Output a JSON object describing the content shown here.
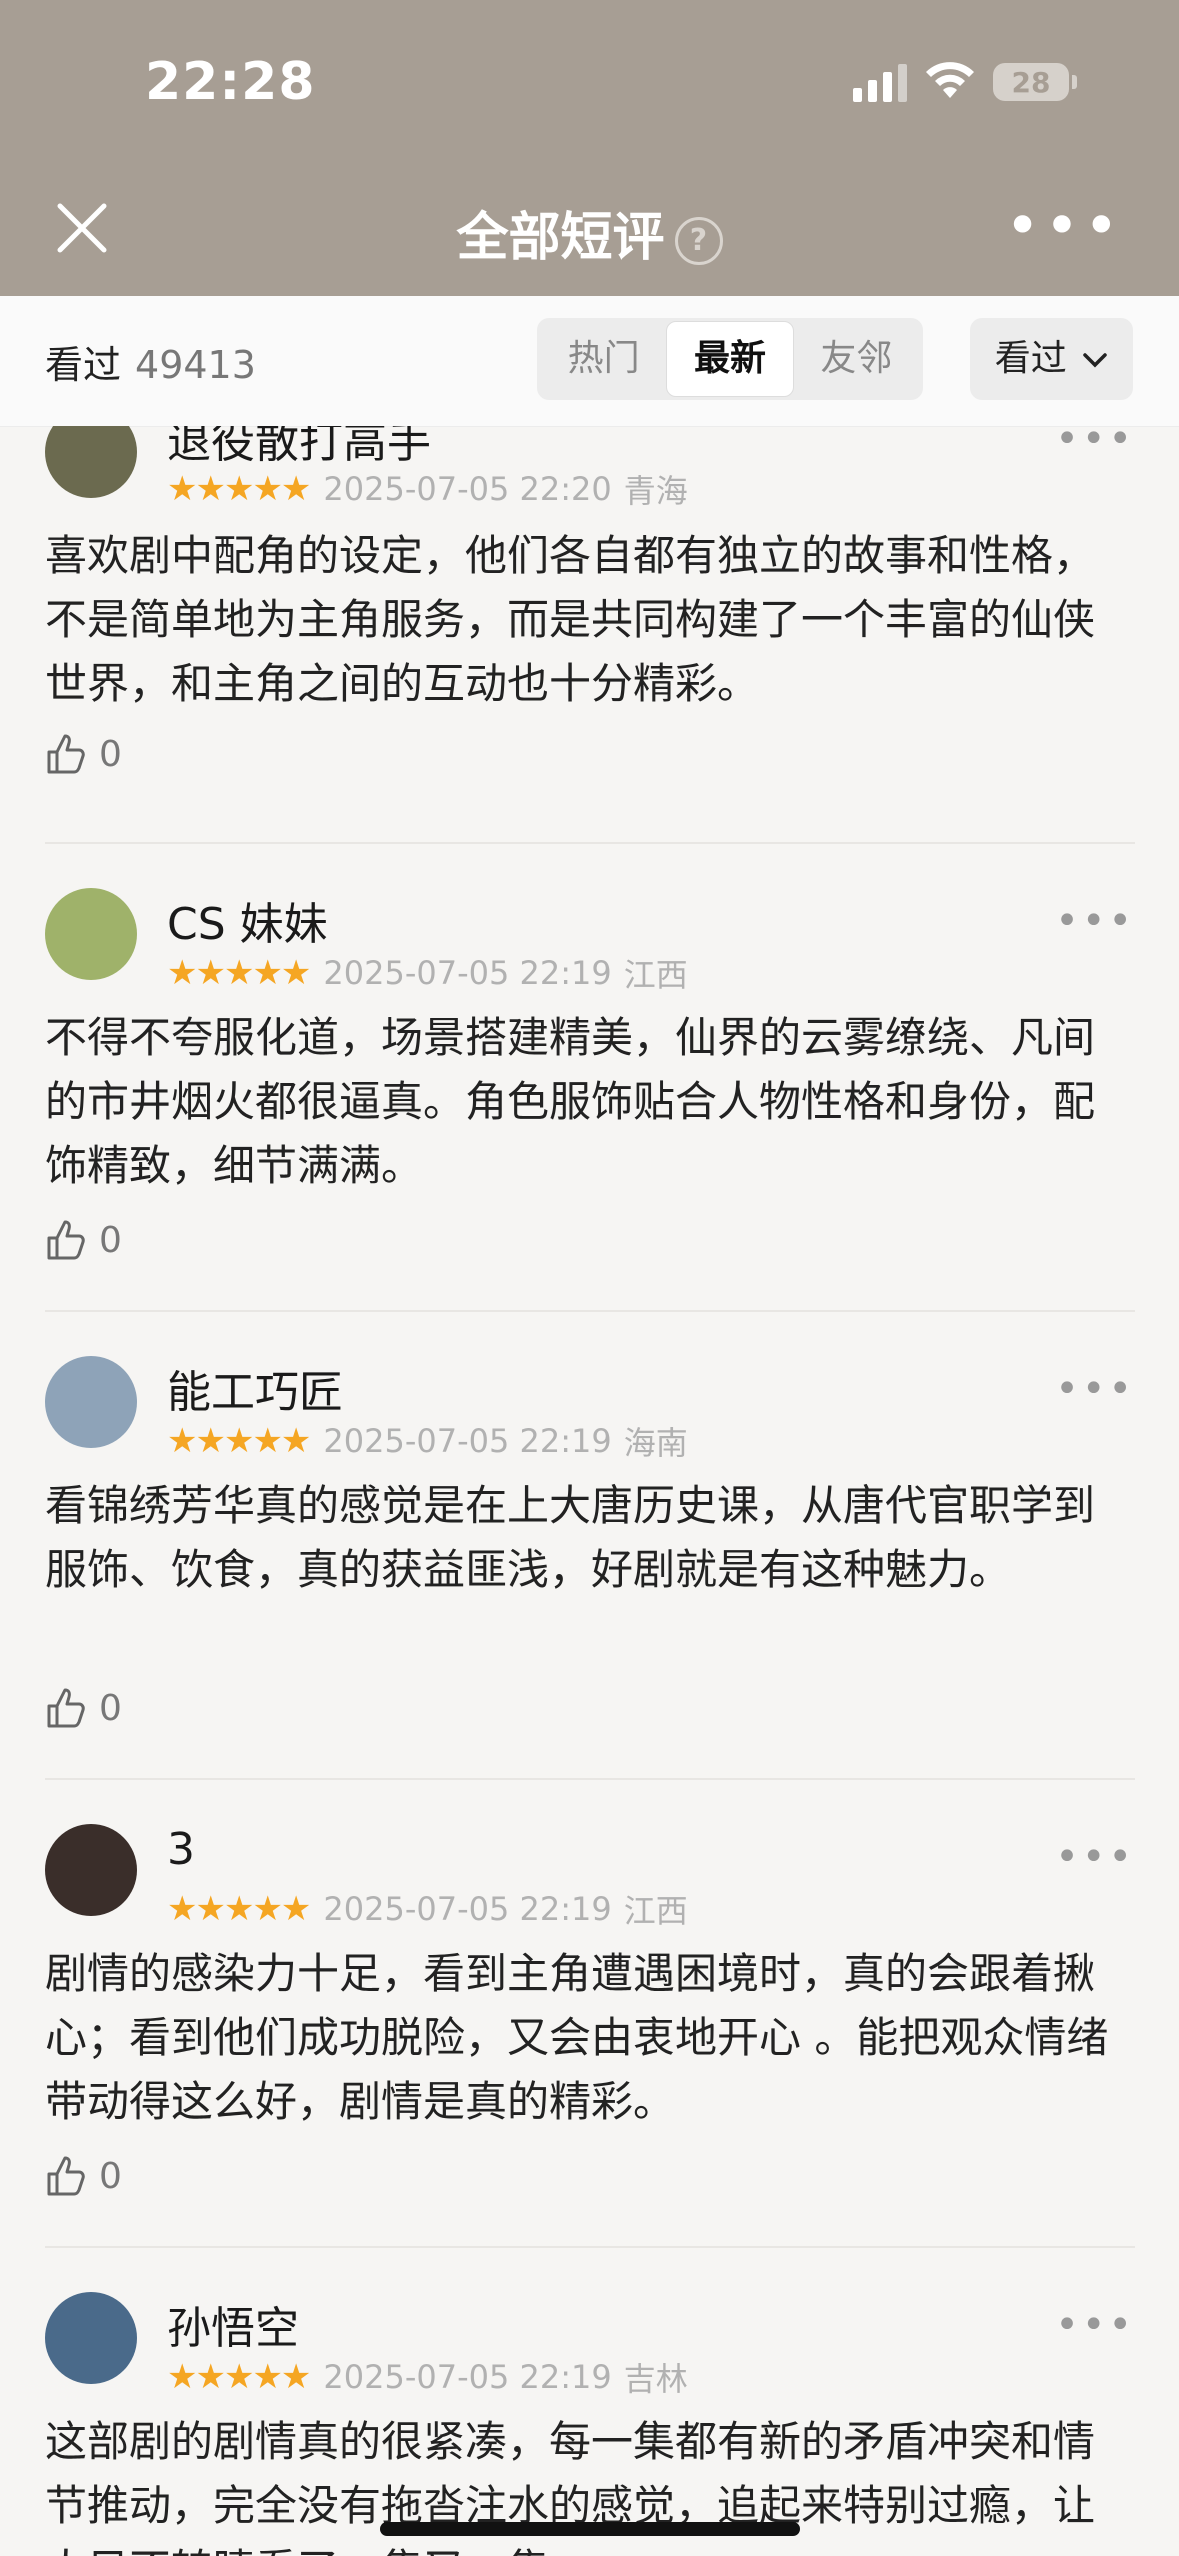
{
  "status": {
    "time": "22:28",
    "battery": "28"
  },
  "header": {
    "title": "全部短评",
    "help_glyph": "?"
  },
  "filter": {
    "count_label": "看过",
    "count_value": "49413",
    "tabs": [
      "热门",
      "最新",
      "友邻"
    ],
    "active_tab_index": 1,
    "dropdown_label": "看过"
  },
  "reviews": [
    {
      "name": "退役散打高手",
      "stars": 5,
      "date": "2025-07-05 22:20",
      "region": "青海",
      "text": "喜欢剧中配角的设定，他们各自都有独立的故事和性格，不是简单地为主角服务，而是共同构建了一个丰富的仙侠世界，和主角之间的互动也十分精彩。",
      "likes": "0",
      "avatar_color": "#6b6a4f"
    },
    {
      "name": "CS 妹妹",
      "stars": 5,
      "date": "2025-07-05 22:19",
      "region": "江西",
      "text": "不得不夸服化道，场景搭建精美，仙界的云雾缭绕、凡间的市井烟火都很逼真。角色服饰贴合人物性格和身份，配饰精致，细节满满。",
      "likes": "0",
      "avatar_color": "#9fb26a"
    },
    {
      "name": "能工巧匠",
      "stars": 5,
      "date": "2025-07-05 22:19",
      "region": "海南",
      "text": "看锦绣芳华真的感觉是在上大唐历史课，从唐代官职学到服饰、饮食，真的获益匪浅，好剧就是有这种魅力。",
      "likes": "0",
      "avatar_color": "#8ea3b8"
    },
    {
      "name": "3",
      "stars": 5,
      "date": "2025-07-05 22:19",
      "region": "江西",
      "text": "剧情的感染力十足，看到主角遭遇困境时，真的会跟着揪心；看到他们成功脱险，又会由衷地开心 。能把观众情绪带动得这么好，剧情是真的精彩。",
      "likes": "0",
      "avatar_color": "#3a2e2a"
    },
    {
      "name": "孙悟空",
      "stars": 5,
      "date": "2025-07-05 22:19",
      "region": "吉林",
      "text": "这部剧的剧情真的很紧凑，每一集都有新的矛盾冲突和情节推动，完全没有拖沓注水的感觉，追起来特别过瘾，让人目不转睛看了一集又一集。",
      "likes": "",
      "avatar_color": "#4a6a8a"
    }
  ]
}
